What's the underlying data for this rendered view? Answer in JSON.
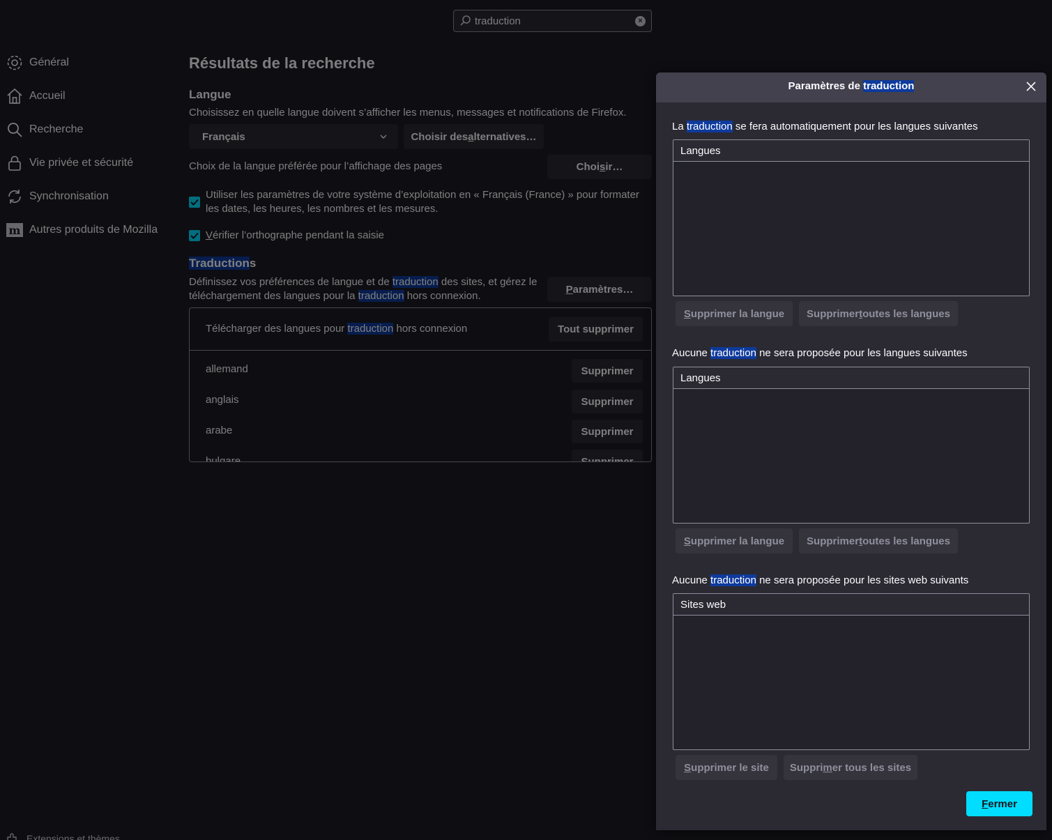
{
  "search": {
    "value": "traduction",
    "clear_icon": "×"
  },
  "sidebar": {
    "items": [
      {
        "label": "Général",
        "icon": "gear-icon"
      },
      {
        "label": "Accueil",
        "icon": "home-icon"
      },
      {
        "label": "Recherche",
        "icon": "search-icon"
      },
      {
        "label": "Vie privée et sécurité",
        "icon": "lock-icon"
      },
      {
        "label": "Synchronisation",
        "icon": "sync-icon"
      },
      {
        "label": "Autres produits de Mozilla",
        "icon": "mozilla-icon"
      }
    ],
    "bottom": "Extensions et thèmes"
  },
  "main": {
    "results_title": "Résultats de la recherche",
    "langue_title": "Langue",
    "langue_desc": "Choisissez en quelle langue doivent s’afficher les menus, messages et notifications de Firefox.",
    "language_select": "Français",
    "choose_alternatives": {
      "pre": "Choisir des ",
      "u": "a",
      "post": "lternatives…"
    },
    "page_lang_label": "Choix de la langue préférée pour l’affichage des pages",
    "choose_btn": {
      "pre": "Choi",
      "u": "s",
      "post": "ir…"
    },
    "locale_checkbox": "Utiliser les paramètres de votre système d’exploitation en « Français (France) » pour formater les dates, les heures, les nombres et les mesures.",
    "spell_checkbox": {
      "u": "V",
      "post": "érifier l’orthographe pendant la saisie"
    },
    "translations_title": {
      "hl": "Traduction",
      "post": "s"
    },
    "translations_desc": {
      "line1_pre": "Définissez vos préférences de langue et de ",
      "line1_hl": "traduction",
      "line1_post": " des sites, et gérez le",
      "line2_pre": "téléchargement des langues pour la ",
      "line2_hl": "traduction",
      "line2_post": " hors connexion."
    },
    "params_btn": {
      "u": "P",
      "post": "aramètres…"
    },
    "download": {
      "head_pre": "Télécharger des langues pour ",
      "head_hl": "traduction",
      "head_post": " hors connexion",
      "delete_all": "Tout supprimer",
      "delete_label": "Supprimer",
      "languages": [
        "allemand",
        "anglais",
        "arabe",
        "bulgare"
      ]
    }
  },
  "dialog": {
    "title_pre": "Paramètres de ",
    "title_hl": "traduction",
    "section1": {
      "pre": "La ",
      "hl": "traduction",
      "post": " se fera automatiquement pour les langues suivantes",
      "header": "Langues"
    },
    "section2": {
      "pre": "Aucune ",
      "hl": "traduction",
      "post": " ne sera proposée pour les langues suivantes",
      "header": "Langues"
    },
    "section3": {
      "pre": "Aucune ",
      "hl": "traduction",
      "post": " ne sera proposée pour les sites web suivants",
      "header": "Sites web"
    },
    "remove_lang": {
      "u": "S",
      "post": "upprimer la langue"
    },
    "remove_all_langs": {
      "pre": "Supprimer ",
      "u": "t",
      "post": "outes les langues"
    },
    "remove_site": {
      "u": "S",
      "post": "upprimer le site"
    },
    "remove_all_sites": {
      "pre": "Suppri",
      "u": "m",
      "post": "er tous les sites"
    },
    "close": {
      "u": "F",
      "post": "ermer"
    }
  },
  "colors": {
    "accent": "#00ddff",
    "highlight": "#0e3a9c",
    "bg": "#1c1b22"
  }
}
